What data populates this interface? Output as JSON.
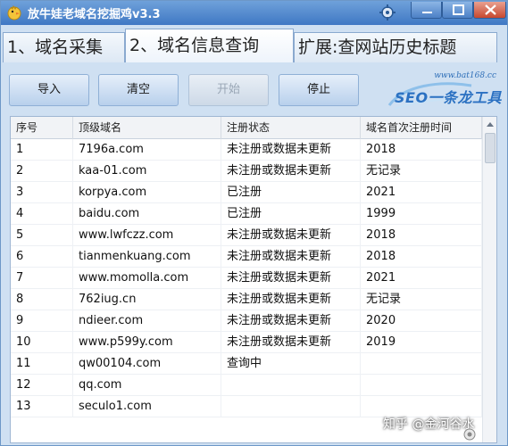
{
  "window": {
    "title": "放牛娃老域名挖掘鸡v3.3"
  },
  "tabs": [
    {
      "label": "1、域名采集"
    },
    {
      "label": "2、域名信息查询"
    },
    {
      "label": "扩展:查网站历史标题"
    }
  ],
  "toolbar": {
    "import_label": "导入",
    "clear_label": "清空",
    "start_label": "开始",
    "stop_label": "停止",
    "logo_url": "www.bat168.cc",
    "logo_text": "SEO一条龙工具"
  },
  "table": {
    "columns": [
      "序号",
      "顶级域名",
      "注册状态",
      "域名首次注册时间"
    ],
    "rows": [
      {
        "seq": "1",
        "domain": "7196a.com",
        "status": "未注册或数据未更新",
        "year": "2018"
      },
      {
        "seq": "2",
        "domain": "kaa-01.com",
        "status": "未注册或数据未更新",
        "year": "无记录"
      },
      {
        "seq": "3",
        "domain": "korpya.com",
        "status": "已注册",
        "year": "2021"
      },
      {
        "seq": "4",
        "domain": "baidu.com",
        "status": "已注册",
        "year": "1999"
      },
      {
        "seq": "5",
        "domain": "www.lwfczz.com",
        "status": "未注册或数据未更新",
        "year": "2018"
      },
      {
        "seq": "6",
        "domain": "tianmenkuang.com",
        "status": "未注册或数据未更新",
        "year": "2018"
      },
      {
        "seq": "7",
        "domain": "www.momolla.com",
        "status": "未注册或数据未更新",
        "year": "2021"
      },
      {
        "seq": "8",
        "domain": "762iug.cn",
        "status": "未注册或数据未更新",
        "year": "无记录"
      },
      {
        "seq": "9",
        "domain": "ndieer.com",
        "status": "未注册或数据未更新",
        "year": "2020"
      },
      {
        "seq": "10",
        "domain": "www.p599y.com",
        "status": "未注册或数据未更新",
        "year": "2019"
      },
      {
        "seq": "11",
        "domain": "qw00104.com",
        "status": "查询中",
        "year": ""
      },
      {
        "seq": "12",
        "domain": "qq.com",
        "status": "",
        "year": ""
      },
      {
        "seq": "13",
        "domain": "seculo1.com",
        "status": "",
        "year": ""
      }
    ]
  },
  "watermark": "知乎 @金河谷水",
  "icons": {
    "app": "chick-icon",
    "settings": "gear-icon",
    "minimize": "minimize-icon",
    "maximize": "maximize-icon",
    "close": "close-icon",
    "scroll_up": "arrow-up-icon"
  },
  "colors": {
    "titlebar": "#4a86cf",
    "window_bg": "#cfe0f2",
    "logo_blue": "#2b71c2",
    "close_red": "#c8482f"
  }
}
